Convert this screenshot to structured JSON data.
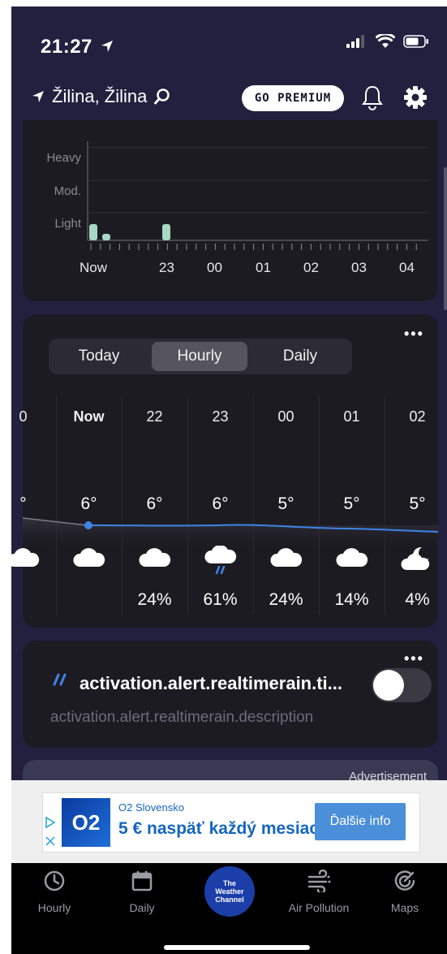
{
  "status": {
    "time": "21:27"
  },
  "header": {
    "location": "Žilina, Žilina",
    "premium_label": "GO PREMIUM"
  },
  "precip_chart": {
    "y_labels": [
      "Heavy",
      "Mod.",
      "Light"
    ],
    "x_labels": [
      "Now",
      "23",
      "00",
      "01",
      "02",
      "03",
      "04"
    ]
  },
  "hourly": {
    "tabs": [
      "Today",
      "Hourly",
      "Daily"
    ],
    "active_tab": "Hourly",
    "more_label": "•••",
    "columns": [
      {
        "hour": "0",
        "temp": "°",
        "pct": "",
        "icon": "cloud-icon"
      },
      {
        "hour": "Now",
        "temp": "6°",
        "pct": "",
        "icon": "cloud-icon"
      },
      {
        "hour": "22",
        "temp": "6°",
        "pct": "24%",
        "icon": "cloud-icon"
      },
      {
        "hour": "23",
        "temp": "6°",
        "pct": "61%",
        "icon": "cloud-rain-icon"
      },
      {
        "hour": "00",
        "temp": "5°",
        "pct": "24%",
        "icon": "cloud-icon"
      },
      {
        "hour": "01",
        "temp": "5°",
        "pct": "14%",
        "icon": "cloud-icon"
      },
      {
        "hour": "02",
        "temp": "5°",
        "pct": "4%",
        "icon": "cloud-moon-icon"
      }
    ]
  },
  "alert": {
    "title": "activation.alert.realtimerain.ti...",
    "description": "activation.alert.realtimerain.description",
    "toggle_on": false
  },
  "ad_peek": {
    "label": "Advertisement"
  },
  "ad_banner": {
    "brand": "O2",
    "advertiser": "O2 Slovensko",
    "headline": "5 € naspäť každý mesiac",
    "cta": "Ďalšie info"
  },
  "tabbar": {
    "items": [
      {
        "label": "Hourly",
        "icon": "clock-icon"
      },
      {
        "label": "Daily",
        "icon": "calendar-icon"
      },
      {
        "label": "The Weather Channel",
        "icon": "twc-logo"
      },
      {
        "label": "Air Pollution",
        "icon": "wind-icon"
      },
      {
        "label": "Maps",
        "icon": "radar-icon"
      }
    ]
  }
}
